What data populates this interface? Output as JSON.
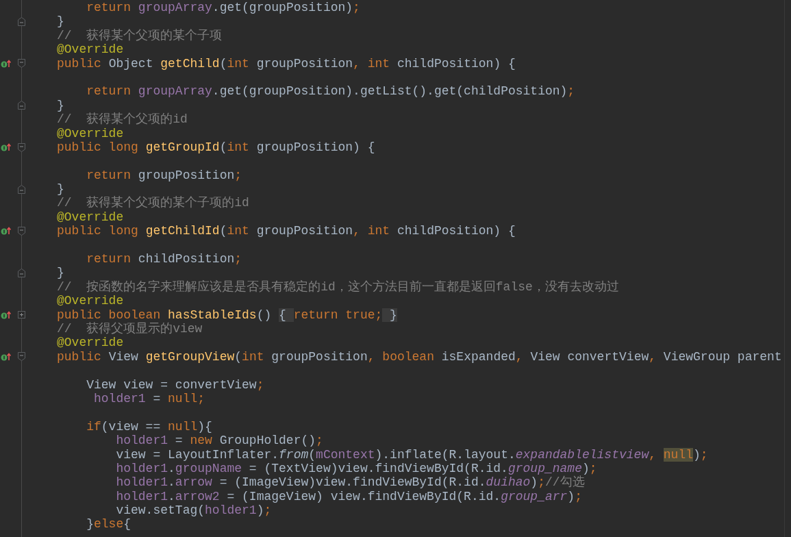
{
  "editor": {
    "lines": [
      {
        "override": false,
        "parts": [
          {
            "kind": "keyword",
            "text": "    return "
          },
          {
            "kind": "field",
            "text": "groupArray"
          },
          {
            "kind": "plain",
            "text": ".get(groupPosition)"
          },
          {
            "kind": "keyword",
            "text": ";"
          }
        ]
      },
      {
        "override": false,
        "fold": {
          "kind": "end"
        },
        "parts": [
          {
            "kind": "plain",
            "text": "}"
          }
        ]
      },
      {
        "override": false,
        "parts": [
          {
            "kind": "comment",
            "text": "//  获得某个父项的某个子项"
          }
        ]
      },
      {
        "override": false,
        "parts": [
          {
            "kind": "annotation",
            "text": "@Override"
          }
        ]
      },
      {
        "override": true,
        "fold": {
          "kind": "start"
        },
        "parts": [
          {
            "kind": "keyword",
            "text": "public "
          },
          {
            "kind": "plain",
            "text": "Object "
          },
          {
            "kind": "method",
            "text": "getChild"
          },
          {
            "kind": "plain",
            "text": "("
          },
          {
            "kind": "keyword",
            "text": "int "
          },
          {
            "kind": "plain",
            "text": "groupPosition"
          },
          {
            "kind": "keyword",
            "text": ", int "
          },
          {
            "kind": "plain",
            "text": "childPosition) {"
          }
        ]
      },
      {
        "override": false
      },
      {
        "override": false,
        "parts": [
          {
            "kind": "keyword",
            "text": "    return "
          },
          {
            "kind": "field",
            "text": "groupArray"
          },
          {
            "kind": "plain",
            "text": ".get(groupPosition).getList().get(childPosition)"
          },
          {
            "kind": "keyword",
            "text": ";"
          }
        ]
      },
      {
        "override": false,
        "fold": {
          "kind": "end"
        },
        "parts": [
          {
            "kind": "plain",
            "text": "}"
          }
        ]
      },
      {
        "override": false,
        "parts": [
          {
            "kind": "comment",
            "text": "//  获得某个父项的id"
          }
        ]
      },
      {
        "override": false,
        "parts": [
          {
            "kind": "annotation",
            "text": "@Override"
          }
        ]
      },
      {
        "override": true,
        "fold": {
          "kind": "start"
        },
        "parts": [
          {
            "kind": "keyword",
            "text": "public long "
          },
          {
            "kind": "method",
            "text": "getGroupId"
          },
          {
            "kind": "plain",
            "text": "("
          },
          {
            "kind": "keyword",
            "text": "int "
          },
          {
            "kind": "plain",
            "text": "groupPosition) {"
          }
        ]
      },
      {
        "override": false
      },
      {
        "override": false,
        "parts": [
          {
            "kind": "keyword",
            "text": "    return "
          },
          {
            "kind": "plain",
            "text": "groupPosition"
          },
          {
            "kind": "keyword",
            "text": ";"
          }
        ]
      },
      {
        "override": false,
        "fold": {
          "kind": "end"
        },
        "parts": [
          {
            "kind": "plain",
            "text": "}"
          }
        ]
      },
      {
        "override": false,
        "parts": [
          {
            "kind": "comment",
            "text": "//  获得某个父项的某个子项的id"
          }
        ]
      },
      {
        "override": false,
        "parts": [
          {
            "kind": "annotation",
            "text": "@Override"
          }
        ]
      },
      {
        "override": true,
        "fold": {
          "kind": "start"
        },
        "parts": [
          {
            "kind": "keyword",
            "text": "public long "
          },
          {
            "kind": "method",
            "text": "getChildId"
          },
          {
            "kind": "plain",
            "text": "("
          },
          {
            "kind": "keyword",
            "text": "int "
          },
          {
            "kind": "plain",
            "text": "groupPosition"
          },
          {
            "kind": "keyword",
            "text": ", int "
          },
          {
            "kind": "plain",
            "text": "childPosition) {"
          }
        ]
      },
      {
        "override": false
      },
      {
        "override": false,
        "parts": [
          {
            "kind": "keyword",
            "text": "    return "
          },
          {
            "kind": "plain",
            "text": "childPosition"
          },
          {
            "kind": "keyword",
            "text": ";"
          }
        ]
      },
      {
        "override": false,
        "fold": {
          "kind": "end"
        },
        "parts": [
          {
            "kind": "plain",
            "text": "}"
          }
        ]
      },
      {
        "override": false,
        "parts": [
          {
            "kind": "comment",
            "text": "//  按函数的名字来理解应该是是否具有稳定的id，这个方法目前一直都是返回false，没有去改动过"
          }
        ]
      },
      {
        "override": false,
        "parts": [
          {
            "kind": "annotation",
            "text": "@Override"
          }
        ]
      },
      {
        "override": true,
        "fold": {
          "kind": "collapsed"
        },
        "parts": [
          {
            "kind": "keyword",
            "text": "public boolean "
          },
          {
            "kind": "method",
            "text": "hasStableIds"
          },
          {
            "kind": "plain",
            "text": "() "
          },
          {
            "kind": "folded",
            "text": "{ "
          },
          {
            "kind": "keyword",
            "text": "return true;"
          },
          {
            "kind": "folded",
            "text": " }"
          }
        ]
      },
      {
        "override": false,
        "parts": [
          {
            "kind": "comment",
            "text": "//  获得父项显示的view"
          }
        ]
      },
      {
        "override": false,
        "parts": [
          {
            "kind": "annotation",
            "text": "@Override"
          }
        ]
      },
      {
        "override": true,
        "fold": {
          "kind": "start"
        },
        "parts": [
          {
            "kind": "keyword",
            "text": "public "
          },
          {
            "kind": "plain",
            "text": "View "
          },
          {
            "kind": "method",
            "text": "getGroupView"
          },
          {
            "kind": "plain",
            "text": "("
          },
          {
            "kind": "keyword",
            "text": "int "
          },
          {
            "kind": "plain",
            "text": "groupPosition"
          },
          {
            "kind": "keyword",
            "text": ", boolean "
          },
          {
            "kind": "plain",
            "text": "isExpanded"
          },
          {
            "kind": "keyword",
            "text": ", "
          },
          {
            "kind": "plain",
            "text": "View convertView"
          },
          {
            "kind": "keyword",
            "text": ", "
          },
          {
            "kind": "plain",
            "text": "ViewGroup parent"
          }
        ]
      },
      {
        "override": false
      },
      {
        "override": false,
        "parts": [
          {
            "kind": "plain",
            "text": "    View view = convertView"
          },
          {
            "kind": "keyword",
            "text": ";"
          }
        ]
      },
      {
        "override": false,
        "parts": [
          {
            "kind": "field",
            "text": "     holder1"
          },
          {
            "kind": "plain",
            "text": " = "
          },
          {
            "kind": "keyword",
            "text": "null;"
          }
        ]
      },
      {
        "override": false
      },
      {
        "override": false,
        "parts": [
          {
            "kind": "keyword",
            "text": "    if"
          },
          {
            "kind": "plain",
            "text": "(view == "
          },
          {
            "kind": "keyword",
            "text": "null"
          },
          {
            "kind": "plain",
            "text": "){"
          }
        ]
      },
      {
        "override": false,
        "parts": [
          {
            "kind": "field",
            "text": "        holder1"
          },
          {
            "kind": "plain",
            "text": " = "
          },
          {
            "kind": "keyword",
            "text": "new "
          },
          {
            "kind": "plain",
            "text": "GroupHolder()"
          },
          {
            "kind": "keyword",
            "text": ";"
          }
        ]
      },
      {
        "override": false,
        "parts": [
          {
            "kind": "plain",
            "text": "        view = LayoutInflater."
          },
          {
            "kind": "italic_method",
            "text": "from"
          },
          {
            "kind": "plain",
            "text": "("
          },
          {
            "kind": "field",
            "text": "mContext"
          },
          {
            "kind": "plain",
            "text": ").inflate(R.layout."
          },
          {
            "kind": "italic_field",
            "text": "expandablelistview"
          },
          {
            "kind": "keyword",
            "text": ", "
          },
          {
            "kind": "match",
            "text": "null"
          },
          {
            "kind": "plain",
            "text": ")"
          },
          {
            "kind": "keyword",
            "text": ";"
          }
        ]
      },
      {
        "override": false,
        "parts": [
          {
            "kind": "field",
            "text": "        holder1"
          },
          {
            "kind": "plain",
            "text": "."
          },
          {
            "kind": "field",
            "text": "groupName"
          },
          {
            "kind": "plain",
            "text": " = (TextView)view.findViewById(R.id."
          },
          {
            "kind": "italic_field",
            "text": "group_name"
          },
          {
            "kind": "plain",
            "text": ")"
          },
          {
            "kind": "keyword",
            "text": ";"
          }
        ]
      },
      {
        "override": false,
        "parts": [
          {
            "kind": "field",
            "text": "        holder1"
          },
          {
            "kind": "plain",
            "text": "."
          },
          {
            "kind": "field",
            "text": "arrow"
          },
          {
            "kind": "plain",
            "text": " = (ImageView)view.findViewById(R.id."
          },
          {
            "kind": "italic_field",
            "text": "duihao"
          },
          {
            "kind": "plain",
            "text": ")"
          },
          {
            "kind": "keyword",
            "text": ";"
          },
          {
            "kind": "comment",
            "text": "//勾选"
          }
        ]
      },
      {
        "override": false,
        "parts": [
          {
            "kind": "field",
            "text": "        holder1"
          },
          {
            "kind": "plain",
            "text": "."
          },
          {
            "kind": "field",
            "text": "arrow2"
          },
          {
            "kind": "plain",
            "text": " = (ImageView) view.findViewById(R.id."
          },
          {
            "kind": "italic_field",
            "text": "group_arr"
          },
          {
            "kind": "plain",
            "text": ")"
          },
          {
            "kind": "keyword",
            "text": ";"
          }
        ]
      },
      {
        "override": false,
        "parts": [
          {
            "kind": "plain",
            "text": "        view.setTag("
          },
          {
            "kind": "field",
            "text": "holder1"
          },
          {
            "kind": "plain",
            "text": ")"
          },
          {
            "kind": "keyword",
            "text": ";"
          }
        ]
      },
      {
        "override": false,
        "parts": [
          {
            "kind": "plain",
            "text": "    }"
          },
          {
            "kind": "keyword",
            "text": "else"
          },
          {
            "kind": "plain",
            "text": "{"
          }
        ]
      }
    ]
  }
}
